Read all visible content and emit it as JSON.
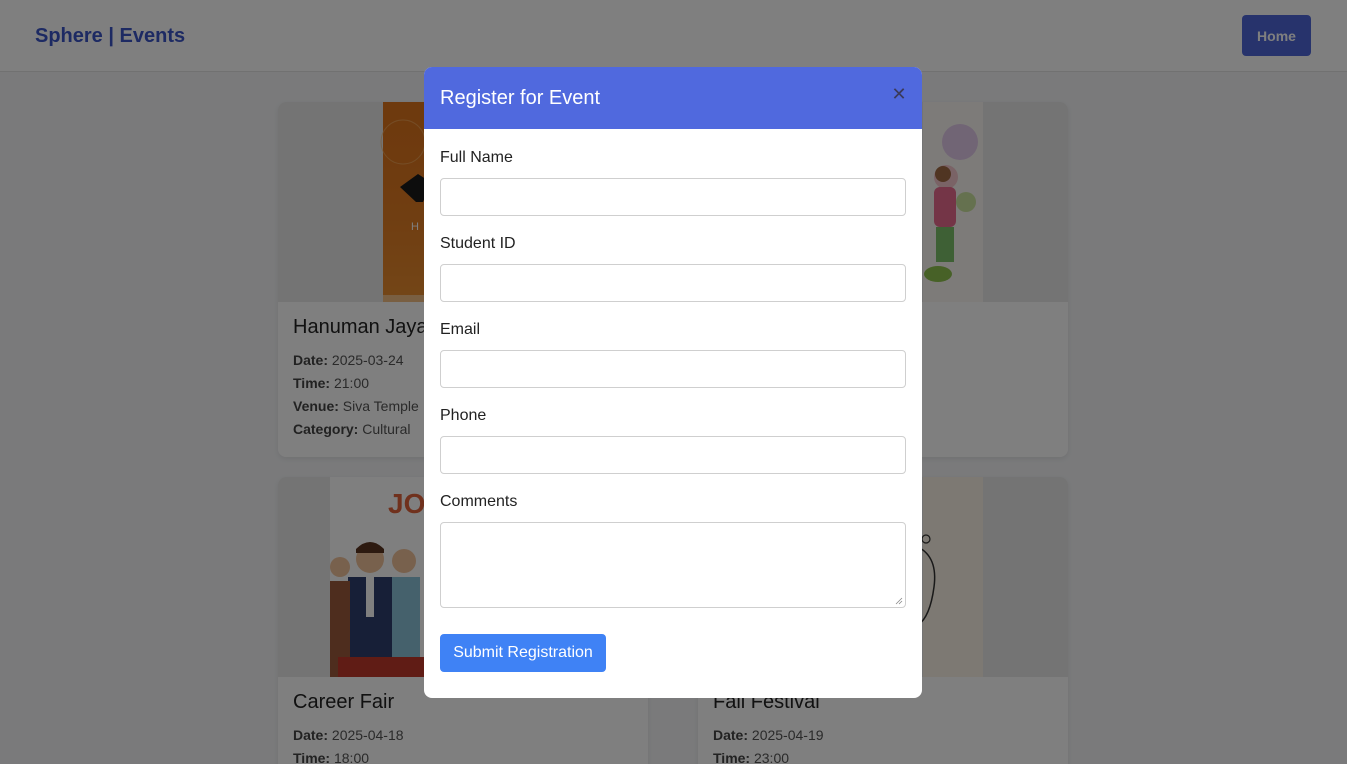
{
  "header": {
    "brand": "Sphere | Events",
    "home_label": "Home"
  },
  "events": [
    {
      "title": "Hanuman Jayanti",
      "date_label": "Date:",
      "date": "2025-03-24",
      "time_label": "Time:",
      "time": "21:00",
      "venue_label": "Venue:",
      "venue": "Siva Temple",
      "category_label": "Category:",
      "category": "Cultural",
      "image_icon": "festival-poster-image"
    },
    {
      "title": "",
      "image_icon": "holi-children-illustration"
    },
    {
      "title": "Career Fair",
      "date_label": "Date:",
      "date": "2025-04-18",
      "time_label": "Time:",
      "time": "18:00",
      "image_icon": "job-fair-people-illustration",
      "image_text": "JO"
    },
    {
      "title": "Fall Festival",
      "date_label": "Date:",
      "date": "2025-04-19",
      "time_label": "Time:",
      "time": "23:00",
      "image_icon": "line-art-illustration"
    }
  ],
  "modal": {
    "title": "Register for Event",
    "close_icon": "close-icon",
    "fields": [
      {
        "label": "Full Name",
        "value": ""
      },
      {
        "label": "Student ID",
        "value": ""
      },
      {
        "label": "Email",
        "value": ""
      },
      {
        "label": "Phone",
        "value": ""
      },
      {
        "label": "Comments",
        "value": ""
      }
    ],
    "submit_label": "Submit Registration"
  },
  "colors": {
    "brand": "#3b55c7",
    "modal_header": "#5069de",
    "submit": "#3f82f5",
    "overlay": "rgba(0,0,0,0.5)"
  }
}
